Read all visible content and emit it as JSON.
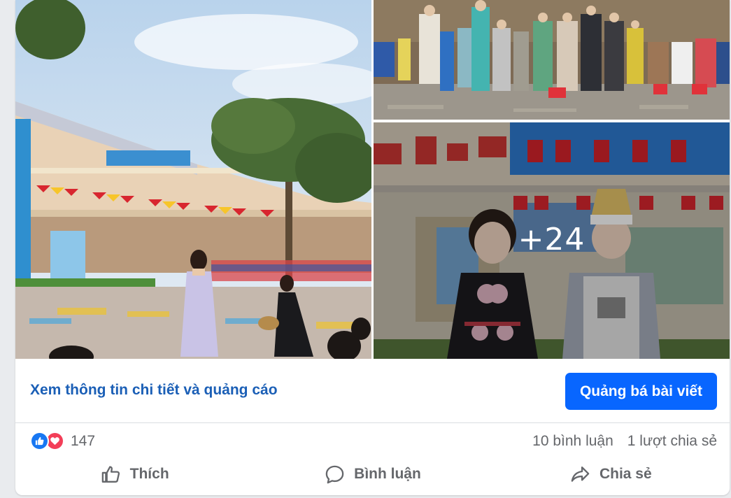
{
  "post": {
    "more_photos_label": "+24",
    "photos": [
      {
        "icon": "school-courtyard-photo"
      },
      {
        "icon": "children-lineup-photo"
      },
      {
        "icon": "kids-costume-photo"
      }
    ]
  },
  "cta": {
    "details_link": "Xem thông tin chi tiết và quảng cáo",
    "boost_button": "Quảng bá bài viết"
  },
  "stats": {
    "reaction_count": "147",
    "comments": "10 bình luận",
    "shares": "1 lượt chia sẻ",
    "reaction_icons": [
      "like-icon",
      "love-icon"
    ]
  },
  "actions": {
    "like": "Thích",
    "comment": "Bình luận",
    "share": "Chia sẻ"
  },
  "colors": {
    "primary": "#0866ff",
    "link": "#1b5fb6",
    "muted_text": "#65676b",
    "like": "#1877f2",
    "love": "#f33e58"
  }
}
